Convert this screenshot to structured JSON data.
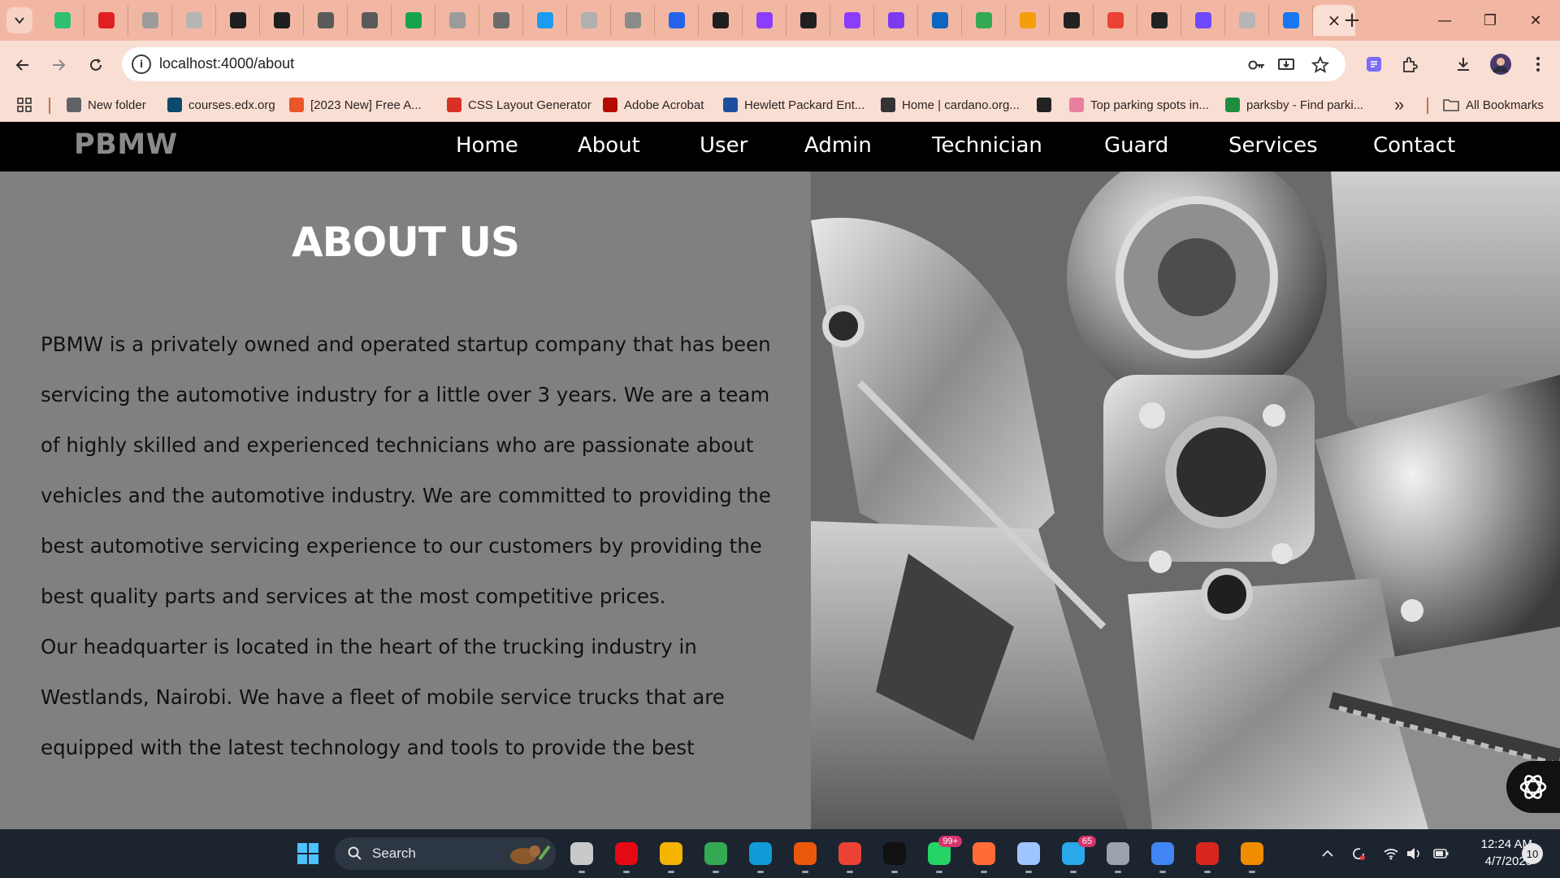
{
  "browser": {
    "tabs": [
      {
        "icon": "play-icon",
        "color": "#2fbf71"
      },
      {
        "icon": "youtube-icon",
        "color": "#e02020"
      },
      {
        "icon": "loading-icon",
        "color": "#9b9b9b"
      },
      {
        "icon": "loading-icon",
        "color": "#b5b5b5"
      },
      {
        "icon": "github-icon",
        "color": "#1f1f1f"
      },
      {
        "icon": "github-icon",
        "color": "#1f1f1f"
      },
      {
        "icon": "hd-icon",
        "color": "#5a5a5a"
      },
      {
        "icon": "alx-icon",
        "color": "#5a5a5a"
      },
      {
        "icon": "sheets-icon",
        "color": "#16a34a"
      },
      {
        "icon": "loading-icon",
        "color": "#9b9b9b"
      },
      {
        "icon": "target-icon",
        "color": "#6b6b6b"
      },
      {
        "icon": "bird-icon",
        "color": "#1d9bf0"
      },
      {
        "icon": "s-icon",
        "color": "#b0b0b0"
      },
      {
        "icon": "dash-icon",
        "color": "#8a8a8a"
      },
      {
        "icon": "calendar-icon",
        "color": "#2563eb"
      },
      {
        "icon": "github-icon",
        "color": "#1f1f1f"
      },
      {
        "icon": "messenger-icon",
        "color": "#8b3dff"
      },
      {
        "icon": "github-icon",
        "color": "#1f1f1f"
      },
      {
        "icon": "messenger-icon",
        "color": "#8b3dff"
      },
      {
        "icon": "b-icon",
        "color": "#7c3aed"
      },
      {
        "icon": "linkedin-icon",
        "color": "#0a66c2"
      },
      {
        "icon": "maps-icon",
        "color": "#34a853"
      },
      {
        "icon": "hand-icon",
        "color": "#f59e0b"
      },
      {
        "icon": "alx-icon",
        "color": "#222222"
      },
      {
        "icon": "gmail-icon",
        "color": "#ea4335"
      },
      {
        "icon": "alx-icon",
        "color": "#222222"
      },
      {
        "icon": "u-icon",
        "color": "#6d4aff"
      },
      {
        "icon": "loading-icon",
        "color": "#b5b5b5"
      },
      {
        "icon": "facebook-icon",
        "color": "#1877f2"
      }
    ],
    "active_tab_close": "×",
    "new_tab": "+",
    "window": {
      "minimize": "—",
      "restore": "❐",
      "close": "✕"
    },
    "address_bar": {
      "url": "localhost:4000/about"
    },
    "bookmarks": [
      {
        "label": "New folder",
        "icon": "folder-icon",
        "color": "#5f6368"
      },
      {
        "label": "courses.edx.org",
        "icon": "edx-icon",
        "color": "#0b4a6e"
      },
      {
        "label": "[2023 New] Free A...",
        "icon": "w-icon",
        "color": "#e8562a"
      },
      {
        "label": "CSS Layout Generator",
        "icon": "grid-icon",
        "color": "#d93025"
      },
      {
        "label": "Adobe Acrobat",
        "icon": "acrobat-icon",
        "color": "#b30b00"
      },
      {
        "label": "Hewlett Packard Ent...",
        "icon": "hpe-icon",
        "color": "#1a4fa0"
      },
      {
        "label": "Home | cardano.org...",
        "icon": "cardano-icon",
        "color": "#333333"
      },
      {
        "label": "",
        "icon": "globe-icon",
        "color": "#222222"
      },
      {
        "label": "Top parking spots in...",
        "icon": "parking-icon",
        "color": "#e97fa0"
      },
      {
        "label": "parksby - Find parki...",
        "icon": "parksby-icon",
        "color": "#1e8e3e"
      }
    ],
    "more_bookmarks": "»",
    "all_bookmarks": "All Bookmarks"
  },
  "site": {
    "brand": "PBMW",
    "nav": [
      "Home",
      "About",
      "User",
      "Admin",
      "Technician",
      "Guard",
      "Services",
      "Contact"
    ],
    "about": {
      "title": "ABOUT US",
      "paragraph1": "PBMW is a privately owned and operated startup company that has been servicing the automotive industry for a little over 3 years. We are a team of highly skilled and experienced technicians who are passionate about vehicles and the automotive industry. We are committed to providing the best automotive servicing experience to our customers by providing the best quality parts and services at the most competitive prices.",
      "paragraph2": "Our headquarter is located in the heart of the trucking industry in Westlands, Nairobi. We have a fleet of mobile service trucks that are equipped with the latest technology and tools to provide the best"
    }
  },
  "taskbar": {
    "search_label": "Search",
    "apps": [
      {
        "name": "task-view",
        "color": "#c9c9c9"
      },
      {
        "name": "netflix",
        "color": "#e50914"
      },
      {
        "name": "file-explorer",
        "color": "#f4b400"
      },
      {
        "name": "chrome",
        "color": "#34a853"
      },
      {
        "name": "edge",
        "color": "#0f9bd7"
      },
      {
        "name": "office",
        "color": "#ea580c"
      },
      {
        "name": "chrome-active",
        "color": "#ea4335"
      },
      {
        "name": "terminal",
        "color": "#111111"
      },
      {
        "name": "whatsapp",
        "color": "#25d366",
        "badge": "99+"
      },
      {
        "name": "postman",
        "color": "#ff6c37"
      },
      {
        "name": "monitor",
        "color": "#9ec5ff"
      },
      {
        "name": "telegram",
        "color": "#29a9eb",
        "badge": "65"
      },
      {
        "name": "settings",
        "color": "#9aa3ad"
      },
      {
        "name": "chrome-alt",
        "color": "#4285f4"
      },
      {
        "name": "acrobat",
        "color": "#d7261e"
      },
      {
        "name": "vlc",
        "color": "#f08c00"
      }
    ],
    "time": "12:24 AM",
    "date": "4/7/2025",
    "notifications": "10"
  }
}
